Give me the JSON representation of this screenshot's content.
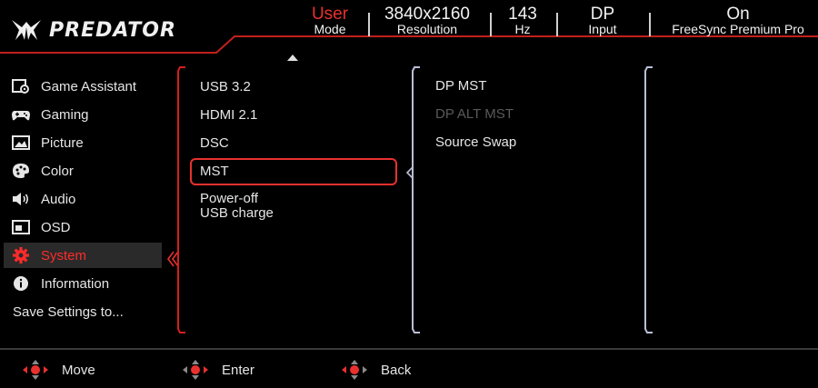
{
  "brand": {
    "logo_text": "PREDATOR"
  },
  "header": {
    "mode": {
      "value": "User",
      "label": "Mode"
    },
    "resolution": {
      "value": "3840x2160",
      "label": "Resolution"
    },
    "refresh": {
      "value": "143",
      "label": "Hz"
    },
    "input": {
      "value": "DP",
      "label": "Input"
    },
    "freesync": {
      "value": "On",
      "label": "FreeSync Premium Pro"
    }
  },
  "sidebar": {
    "items": [
      {
        "label": "Game Assistant",
        "icon": "game-assistant-icon"
      },
      {
        "label": "Gaming",
        "icon": "gamepad-icon"
      },
      {
        "label": "Picture",
        "icon": "picture-icon"
      },
      {
        "label": "Color",
        "icon": "palette-icon"
      },
      {
        "label": "Audio",
        "icon": "speaker-icon"
      },
      {
        "label": "OSD",
        "icon": "osd-icon"
      },
      {
        "label": "System",
        "icon": "gear-icon",
        "active": true
      },
      {
        "label": "Information",
        "icon": "info-icon"
      }
    ],
    "save": "Save Settings to..."
  },
  "system_menu": {
    "items": [
      {
        "label": "USB 3.2"
      },
      {
        "label": "HDMI 2.1"
      },
      {
        "label": "DSC"
      },
      {
        "label": "MST",
        "selected": true
      },
      {
        "label_line1": "Power-off",
        "label_line2": "USB charge"
      }
    ]
  },
  "mst_menu": {
    "items": [
      {
        "label": "DP MST",
        "enabled": true
      },
      {
        "label": "DP ALT MST",
        "enabled": false
      },
      {
        "label": "Source Swap",
        "enabled": true
      }
    ]
  },
  "footer": {
    "move": "Move",
    "enter": "Enter",
    "back": "Back"
  },
  "colors": {
    "accent": "#e8312f",
    "active_text": "#ff2a2a",
    "bracket_blue": "#b9bfd6"
  }
}
